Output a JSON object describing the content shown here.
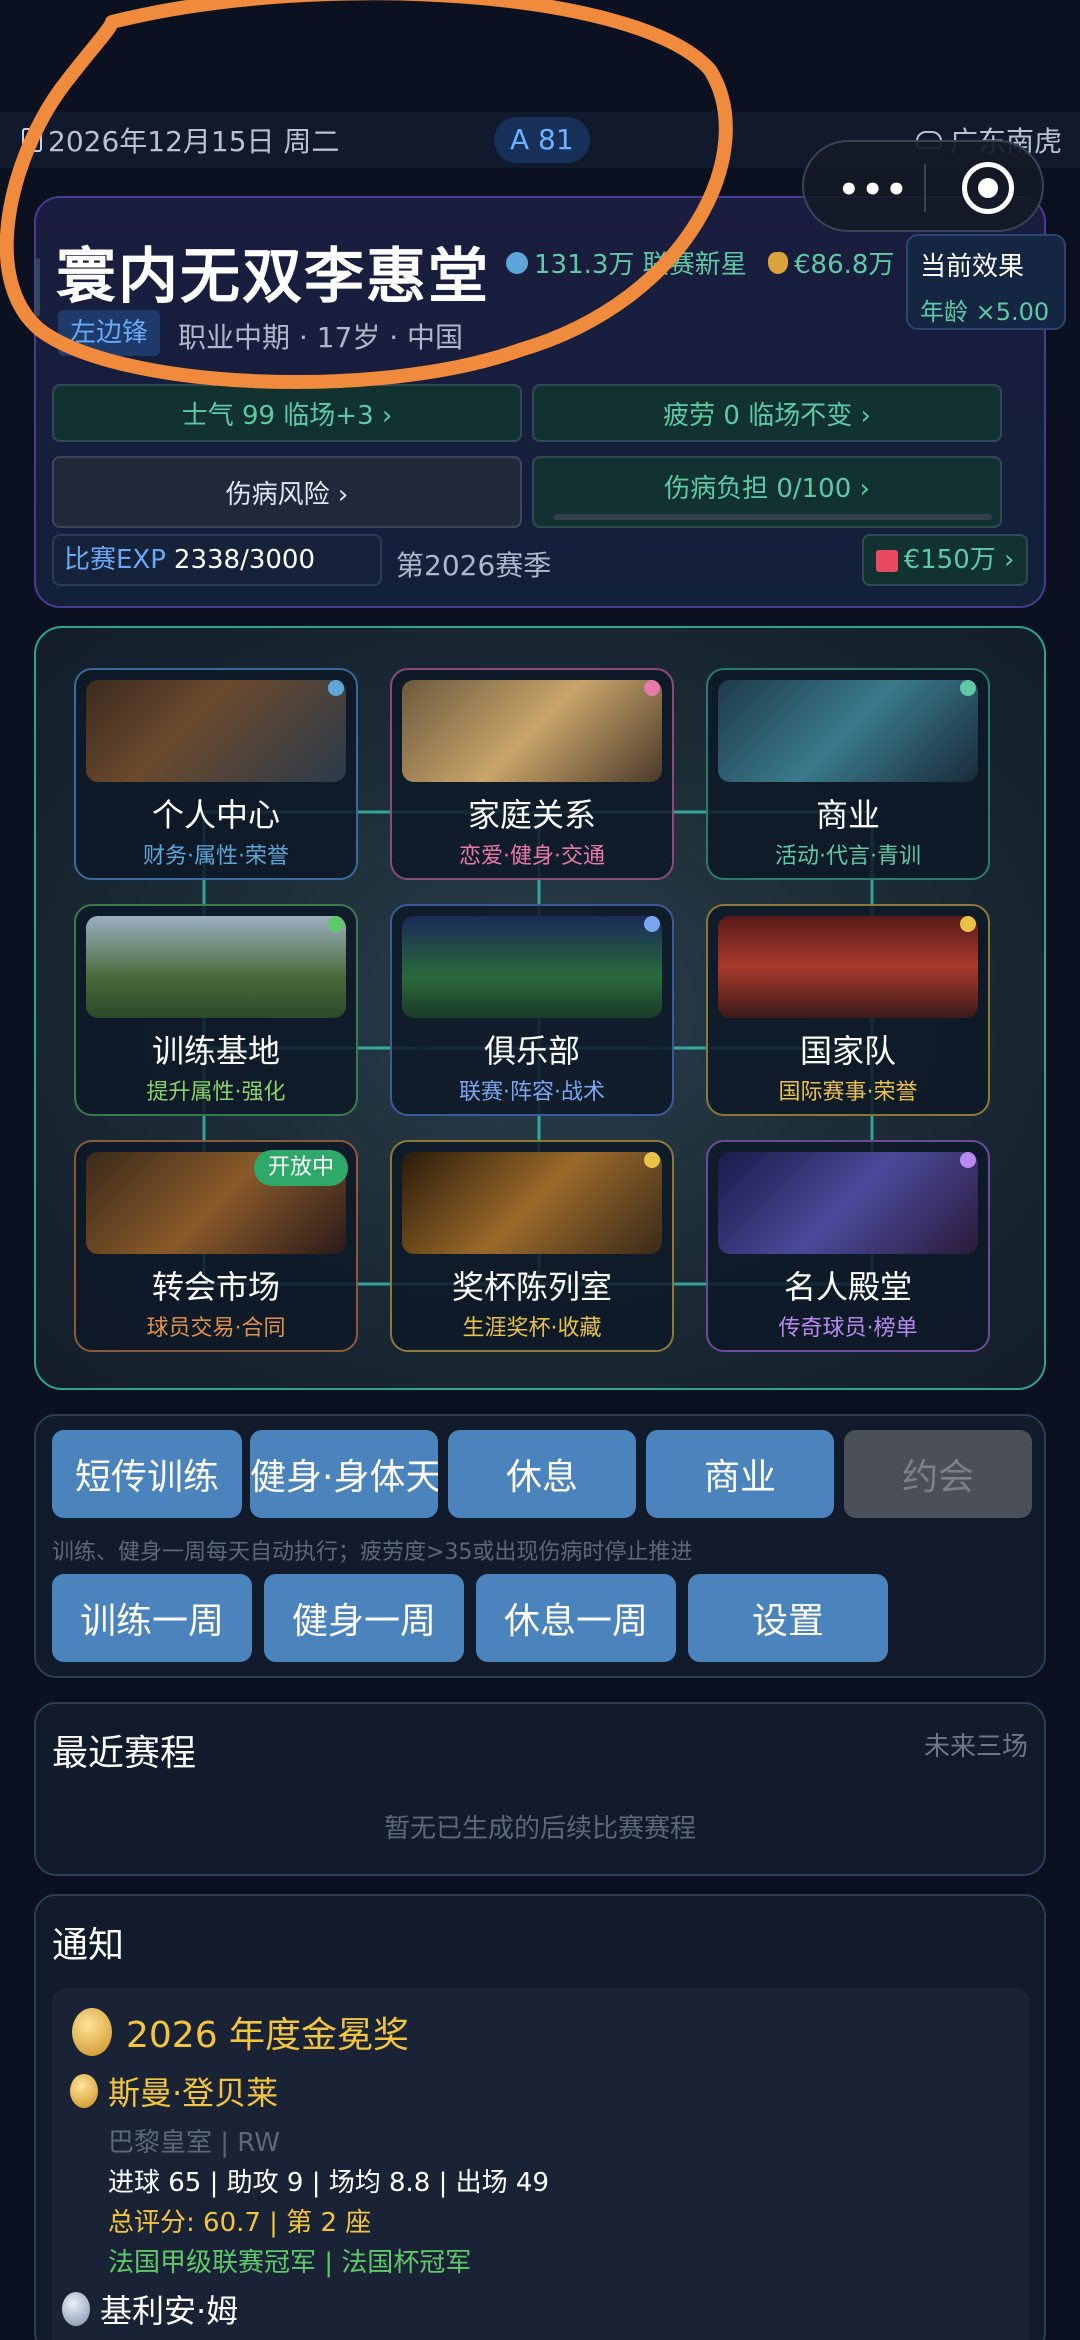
{
  "header": {
    "date": "2026年12月15日 周二",
    "rating": "A 81",
    "club": "广东南虎"
  },
  "capsule": {
    "more_glyph": "•••",
    "close_icon": "target-icon"
  },
  "player": {
    "name": "寰内无双李惠堂",
    "fans": "131.3万 联赛新星",
    "money": "€86.8万",
    "position": "左边锋",
    "meta": "职业中期 · 17岁 · 中国"
  },
  "effect": {
    "title": "当前效果",
    "value": "年龄 ×5.00"
  },
  "stats": {
    "morale": "士气 99  临场+3 ›",
    "fatigue": "疲劳 0  临场不变 ›",
    "injury_risk": "伤病风险 ›",
    "injury_burden": "伤病负担 0/100 ›",
    "injury_burden_fraction": 0
  },
  "exp": {
    "label": "比赛EXP",
    "value": "2338/3000"
  },
  "season": "第2026赛季",
  "market_value": "€150万 ›",
  "tiles": [
    {
      "title": "个人中心",
      "sub": "财务·属性·荣誉",
      "sub_color": "#5fa6d8",
      "border": "#3a6a9a",
      "dot": "#5fa6d8"
    },
    {
      "title": "家庭关系",
      "sub": "恋爱·健身·交通",
      "sub_color": "#e87aa8",
      "border": "#8a4a7a",
      "dot": "#e87aa8"
    },
    {
      "title": "商业",
      "sub": "活动·代言·青训",
      "sub_color": "#5fc9a5",
      "border": "#2a7a6a",
      "dot": "#5fc9a5"
    },
    {
      "title": "训练基地",
      "sub": "提升属性·强化",
      "sub_color": "#8ad36a",
      "border": "#3a7a4a",
      "dot": "#5fc96a"
    },
    {
      "title": "俱乐部",
      "sub": "联赛·阵容·战术",
      "sub_color": "#7aa6f0",
      "border": "#3a5a9a",
      "dot": "#7aa6f0"
    },
    {
      "title": "国家队",
      "sub": "国际赛事·荣誉",
      "sub_color": "#e9c24a",
      "border": "#8a7a3a",
      "dot": "#e9c24a"
    },
    {
      "title": "转会市场",
      "sub": "球员交易·合同",
      "sub_color": "#e0904a",
      "border": "#8a5a3a",
      "dot": "",
      "badge": "开放中"
    },
    {
      "title": "奖杯陈列室",
      "sub": "生涯奖杯·收藏",
      "sub_color": "#e9c24a",
      "border": "#8a7a3a",
      "dot": "#e9c24a"
    },
    {
      "title": "名人殿堂",
      "sub": "传奇球员·榜单",
      "sub_color": "#b88af0",
      "border": "#6a4a9a",
      "dot": "#b88af0"
    }
  ],
  "actions": {
    "row1": [
      "短传训练",
      "健身·身体天赋",
      "休息",
      "商业",
      "约会"
    ],
    "hint": "训练、健身一周每天自动执行；疲劳度>35或出现伤病时停止推进",
    "row2": [
      "训练一周",
      "健身一周",
      "休息一周",
      "设置"
    ]
  },
  "schedule": {
    "title": "最近赛程",
    "note": "未来三场",
    "empty": "暂无已生成的后续比赛赛程"
  },
  "notice": {
    "title": "通知",
    "award": "2026 年度金冕奖",
    "winner_name": "斯曼·登贝莱",
    "winner_club": "巴黎皇室 | RW",
    "winner_stats": "进球 65 | 助攻 9 | 场均 8.8 | 出场 49",
    "winner_score": "总评分: 60.7 | 第 2 座",
    "winner_honors": "法国甲级联赛冠军 | 法国杯冠军",
    "second_name": "基利安·姆"
  }
}
